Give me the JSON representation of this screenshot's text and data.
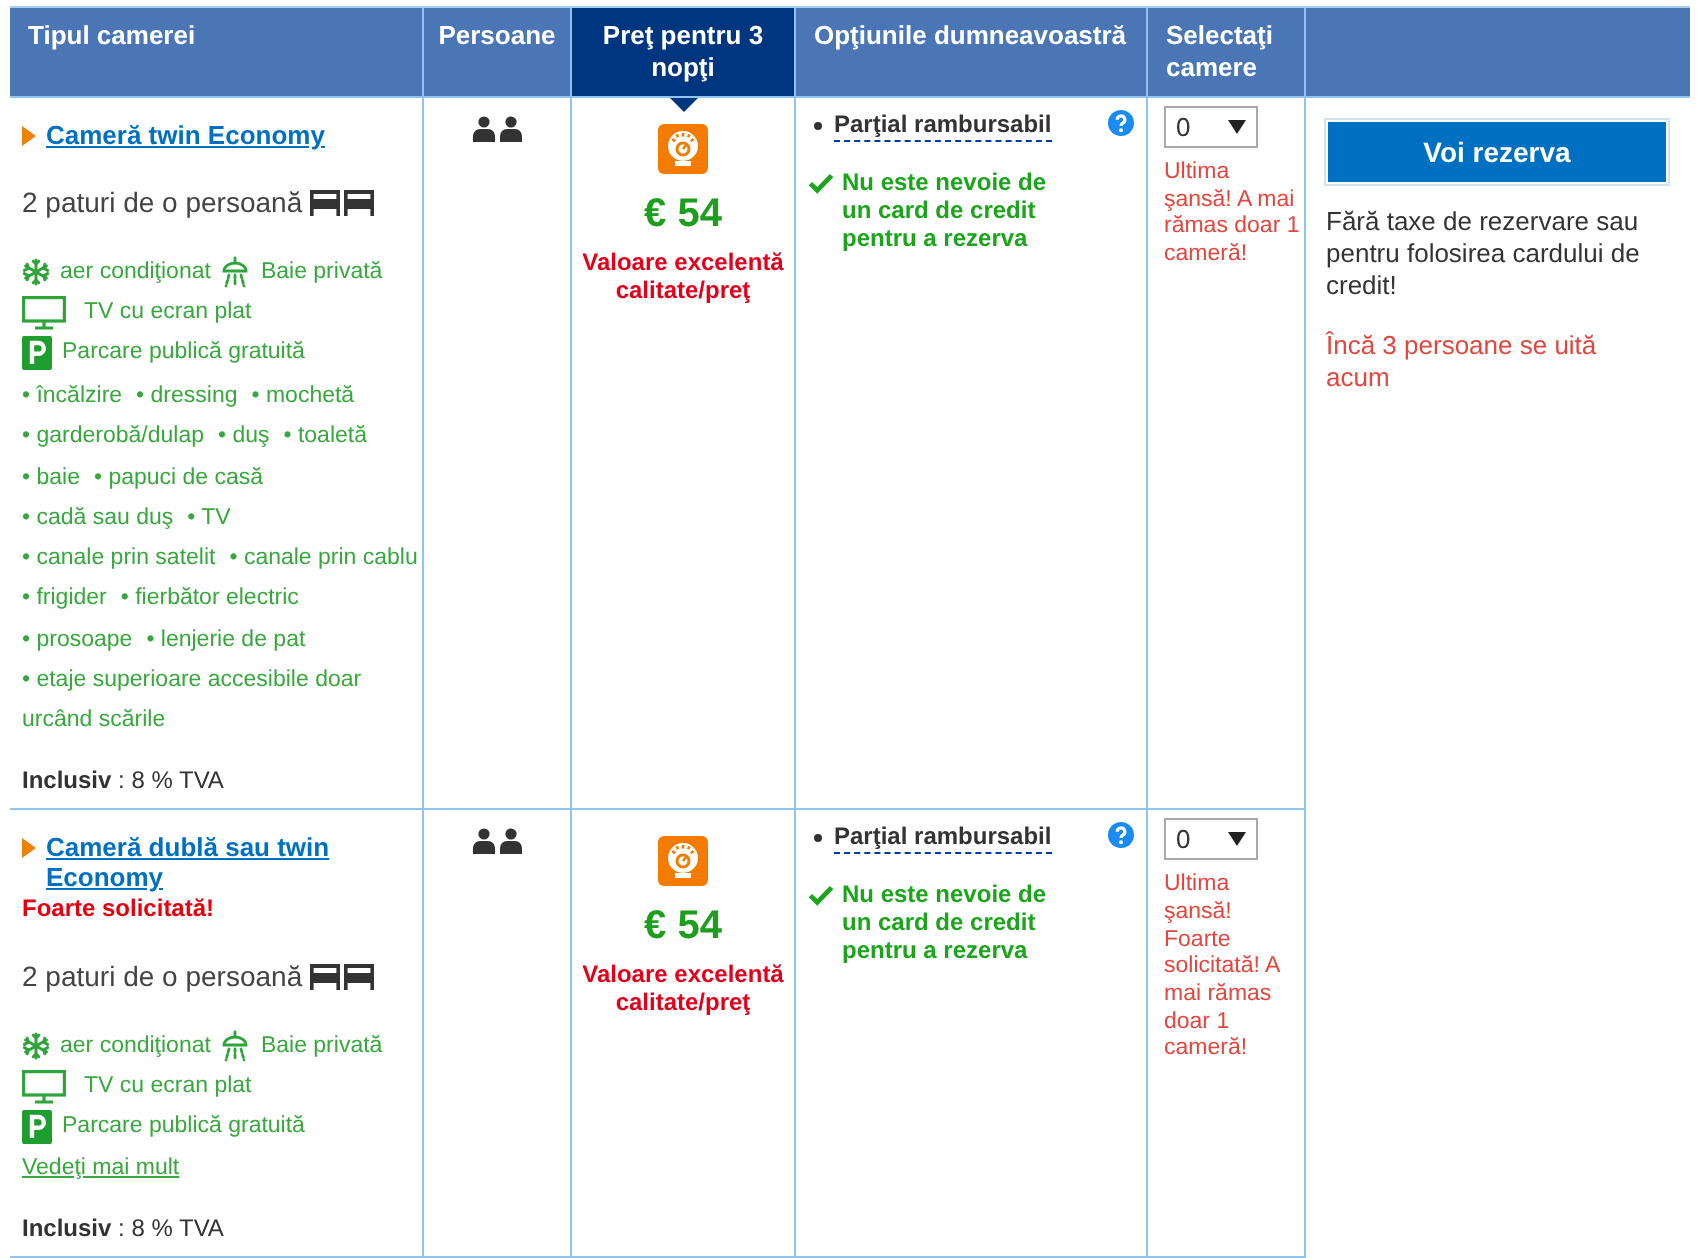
{
  "columns": [
    {
      "label": "Tipul camerei",
      "selected": false
    },
    {
      "label": "Persoane",
      "selected": false
    },
    {
      "label": "Preţ pentru 3 nopţi",
      "selected": true
    },
    {
      "label": "Opţiunile dumneavoastră",
      "selected": false
    },
    {
      "label": "Selectaţi camere",
      "selected": false
    }
  ],
  "rooms": [
    {
      "name": "Cameră twin Economy",
      "beds": "2 paturi de o persoană",
      "facilities": [
        {
          "kind": "air-conditioning",
          "label": "aer condiţionat"
        },
        {
          "kind": "bathroom",
          "label": "Baie privată"
        },
        {
          "kind": "tv",
          "label": "TV cu ecran plat"
        },
        {
          "kind": "parking",
          "label": "Parcare publică gratuită"
        }
      ],
      "extras": [
        "• încălzire",
        "• dressing",
        "• mochetă",
        "• garderobă/dulap",
        "• duş",
        "• toaletă",
        "• baie",
        "• papuci de casă",
        "• cadă sau duş",
        "• TV",
        "• canale prin satelit",
        "• canale prin cablu",
        "• frigider",
        "• fierbător electric",
        "• prosoape",
        "• lenjerie de pat",
        "• etaje superioare accesibile doar urcând scările"
      ],
      "tax": "**Inclusiv** : 8 % TVA",
      "price": "€ 54",
      "price_note": "Valoare excelentă calitate/preţ",
      "policy": "Parţial rambursabil",
      "perk": "Nu este nevoie de un card de credit pentru a rezerva",
      "quantity": "0",
      "urgency": "Ultima şansă! A mai rămas doar 1 cameră!"
    },
    {
      "name": "Cameră dublă sau twin Economy",
      "demand": "Foarte solicitată!",
      "beds": "2 paturi de o persoană",
      "facilities": [
        {
          "kind": "air-conditioning",
          "label": "aer condiţionat"
        },
        {
          "kind": "bathroom",
          "label": "Baie privată"
        },
        {
          "kind": "tv",
          "label": "TV cu ecran plat"
        },
        {
          "kind": "parking",
          "label": "Parcare publică gratuită"
        }
      ],
      "more_link": "Vedeţi mai mult",
      "tax": "**Inclusiv** : 8 % TVA",
      "price": "€ 54",
      "price_note": "Valoare excelentă calitate/preţ",
      "policy": "Parţial rambursabil",
      "perk": "Nu este nevoie de un card de credit pentru a rezerva",
      "quantity": "0",
      "urgency": "Ultima şansă! Foarte solicitată! A mai rămas doar 1 cameră!"
    }
  ],
  "booking": {
    "button": "Voi rezerva",
    "note": "Fără taxe de rezervare sau pentru folosirea cardului de credit!",
    "viewers": "Încă 3 persoane se uită acum"
  }
}
